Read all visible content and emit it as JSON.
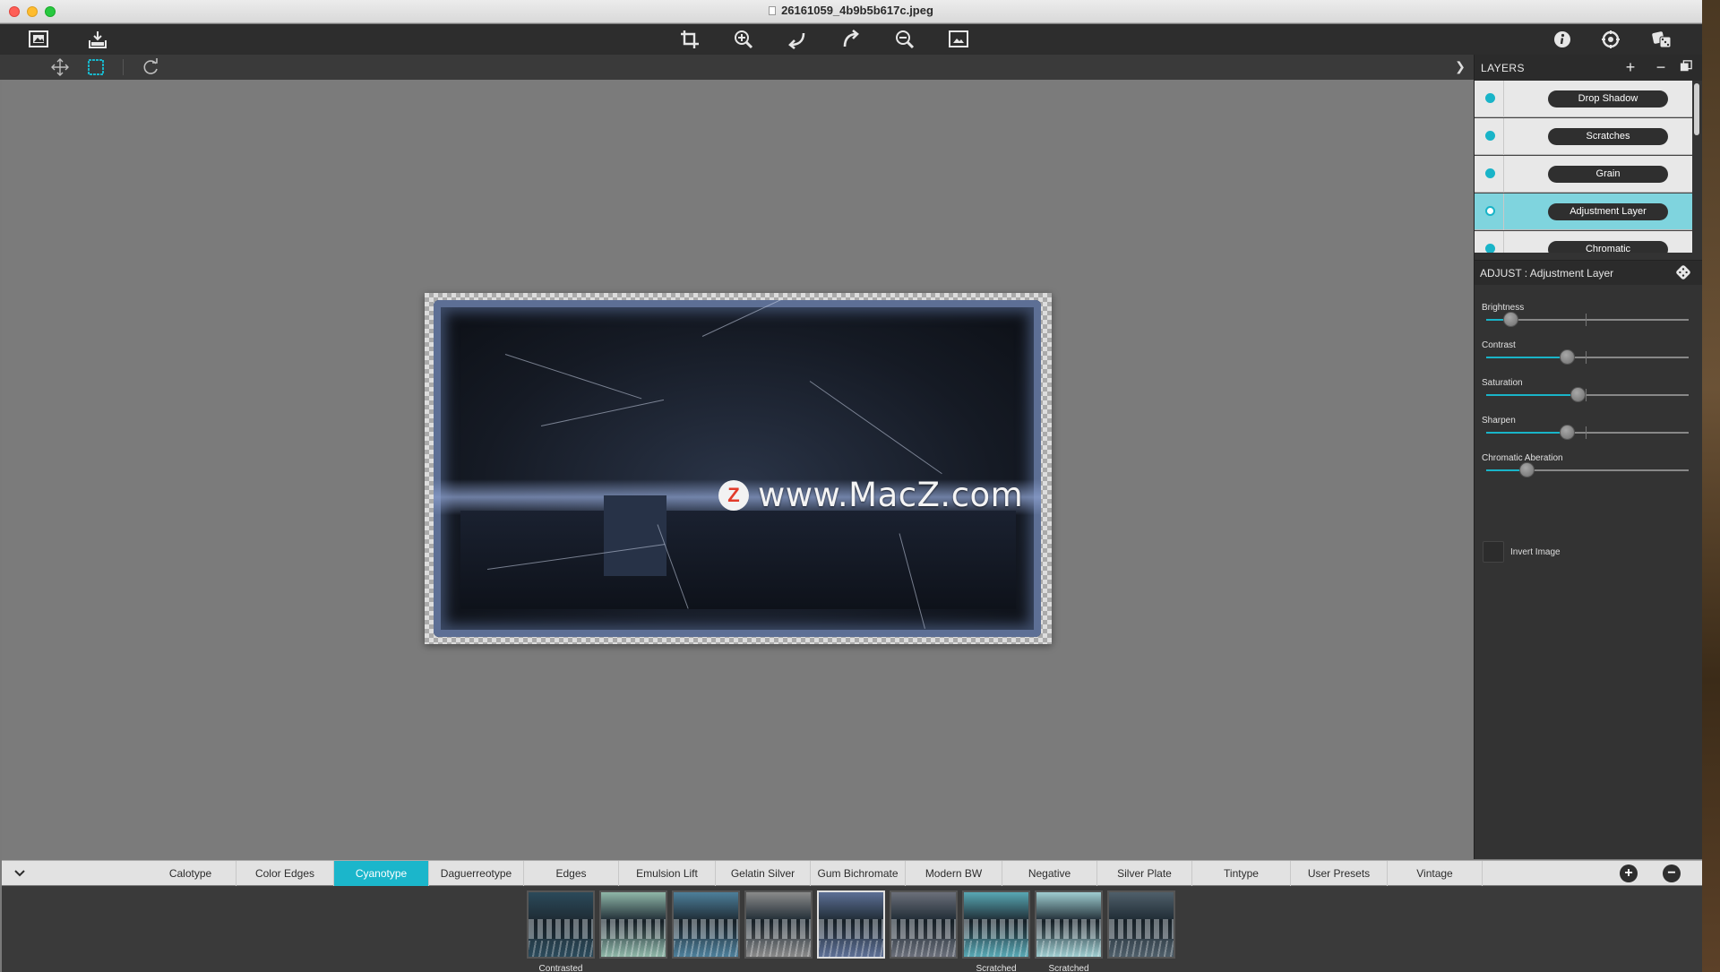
{
  "window": {
    "title": "26161059_4b9b5b617c.jpeg"
  },
  "toolbar": {
    "left_icons": [
      "open-image-icon",
      "export-icon"
    ],
    "center_icons": [
      "crop-icon",
      "zoom-in-icon",
      "undo-icon",
      "redo-icon",
      "zoom-out-icon",
      "fit-screen-icon"
    ],
    "right_icons": [
      "info-icon",
      "settings-icon",
      "random-dice-icon"
    ]
  },
  "subtoolbar": {
    "icons": [
      "move-tool-icon",
      "selection-tool-icon",
      "rotate-icon"
    ]
  },
  "canvas": {
    "watermark_logo": "Z",
    "watermark_text": "www.MacZ.com",
    "background": "#7b7b7b"
  },
  "layers": {
    "title": "LAYERS",
    "add": "+",
    "remove": "−",
    "items": [
      {
        "label": "Drop Shadow",
        "selected": false
      },
      {
        "label": "Scratches",
        "selected": false
      },
      {
        "label": "Grain",
        "selected": false
      },
      {
        "label": "Adjustment Layer",
        "selected": true
      },
      {
        "label": "Chromatic",
        "selected": false
      }
    ]
  },
  "adjust": {
    "title": "ADJUST : Adjustment Layer",
    "sliders": [
      {
        "label": "Brightness",
        "value": 0.12
      },
      {
        "label": "Contrast",
        "value": 0.4
      },
      {
        "label": "Saturation",
        "value": 0.45
      },
      {
        "label": "Sharpen",
        "value": 0.4
      },
      {
        "label": "Chromatic Aberation",
        "value": 0.2
      }
    ],
    "invert_label": "Invert Image",
    "invert_checked": false
  },
  "categories": {
    "tabs": [
      "Calotype",
      "Color Edges",
      "Cyanotype",
      "Daguerreotype",
      "Edges",
      "Emulsion Lift",
      "Gelatin Silver",
      "Gum Bichromate",
      "Modern BW",
      "Negative",
      "Silver Plate",
      "Tintype",
      "User Presets",
      "Vintage"
    ],
    "active": "Cyanotype",
    "add": "+",
    "remove": "−"
  },
  "thumbnails": {
    "items": [
      {
        "label": "Contrasted",
        "tint": "#2b4a5a",
        "selected": false
      },
      {
        "label": "",
        "tint": "#8fb7a8",
        "selected": false
      },
      {
        "label": "",
        "tint": "#4d7f9a",
        "selected": false
      },
      {
        "label": "",
        "tint": "#8a8a8a",
        "selected": false
      },
      {
        "label": "",
        "tint": "#5d6f95",
        "selected": true
      },
      {
        "label": "",
        "tint": "#6b6f7a",
        "selected": false
      },
      {
        "label": "Scratched",
        "tint": "#58a8b4",
        "selected": false
      },
      {
        "label": "Scratched",
        "tint": "#9fcdd0",
        "selected": false
      },
      {
        "label": "",
        "tint": "#4f5f6a",
        "selected": false
      }
    ]
  },
  "colors": {
    "accent": "#1bb6cb",
    "toolbar": "#2d2d2d",
    "panel": "#333333"
  }
}
